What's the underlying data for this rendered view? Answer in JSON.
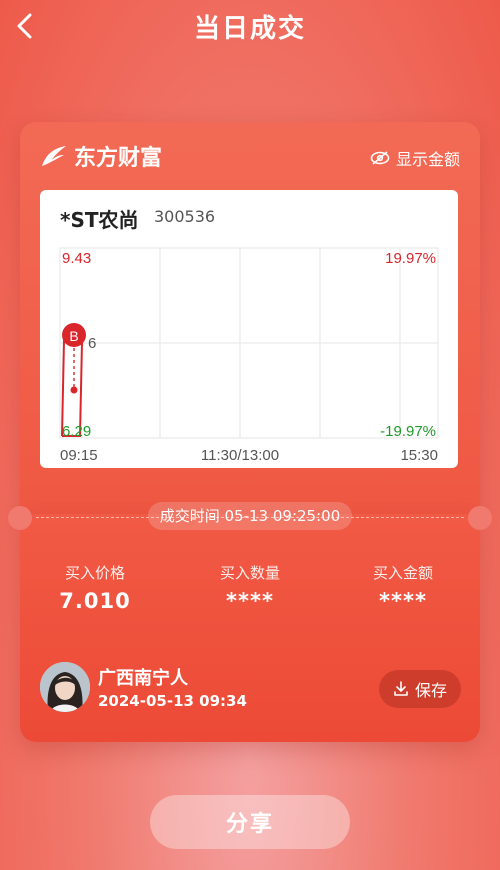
{
  "header": {
    "title": "当日成交"
  },
  "card": {
    "brand": "东方财富",
    "show_amount": "显示金额",
    "stock": {
      "name": "*ST农尚",
      "code": "300536"
    },
    "axis": {
      "y_top_price": "9.43",
      "y_mid_price_fragment": "6",
      "y_bottom_price": "6.29",
      "y_top_pct": "19.97%",
      "y_bottom_pct": "-19.97%",
      "x_start": "09:15",
      "x_mid": "11:30/13:00",
      "x_end": "15:30"
    },
    "buy_marker": "B",
    "trade_time": "成交时间 05-13 09:25:00",
    "stats": [
      {
        "label": "买入价格",
        "value": "7.010"
      },
      {
        "label": "买入数量",
        "value": "****"
      },
      {
        "label": "买入金额",
        "value": "****"
      }
    ],
    "user": {
      "name": "广西南宁人",
      "time": "2024-05-13 09:34"
    },
    "save_label": "保存"
  },
  "share_label": "分享",
  "colors": {
    "up": "#d8262b",
    "down": "#1f9a2c",
    "accent": "#ef5843"
  },
  "chart_data": {
    "type": "line",
    "x_labels": [
      "09:15",
      "11:30/13:00",
      "15:30"
    ],
    "y_range_price": [
      6.29,
      9.43
    ],
    "y_range_pct": [
      -19.97,
      19.97
    ],
    "buy_price": 7.01,
    "buy_time": "09:25:00"
  }
}
